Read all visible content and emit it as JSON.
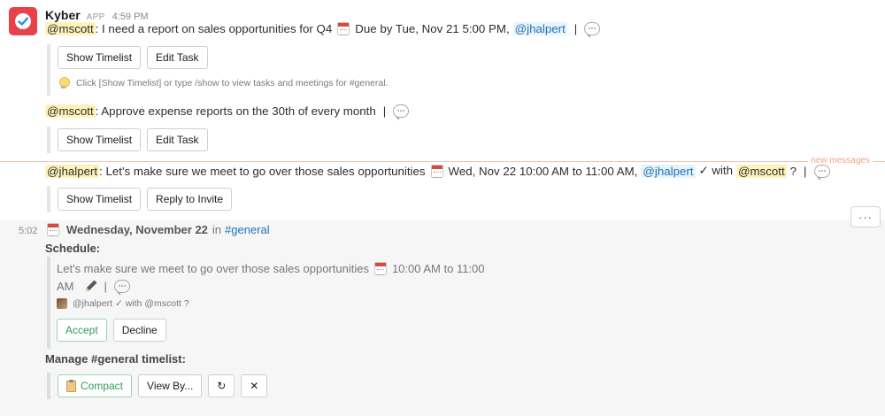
{
  "message": {
    "sender": "Kyber",
    "badge": "APP",
    "time": "4:59 PM"
  },
  "tasks": [
    {
      "assignee": "@mscott",
      "text": ": I need a report on sales opportunities for Q4",
      "due": "Due by Tue, Nov 21  5:00 PM,",
      "creator": "@jhalpert",
      "separator": "|",
      "buttons": [
        "Show Timelist",
        "Edit Task"
      ]
    },
    {
      "assignee": "@mscott",
      "text": ": Approve expense reports on the 30th of every month",
      "separator": "|",
      "buttons": [
        "Show Timelist",
        "Edit Task"
      ]
    }
  ],
  "hint": "Click [Show Timelist] or type /show to view tasks and meetings for #general.",
  "new_messages_label": "new messages",
  "meeting": {
    "organizer": "@jhalpert",
    "text": ": Let's make sure we meet to go over those sales opportunities",
    "when": "Wed, Nov 22 10:00 AM to 11:00 AM,",
    "attendee1": "@jhalpert",
    "check_with": "✓ with",
    "attendee2": "@mscott",
    "status": "?",
    "separator": "|",
    "buttons": [
      "Show Timelist",
      "Reply to Invite"
    ]
  },
  "thread": {
    "time": "5:02",
    "more_label": "···",
    "date": "Wednesday, November 22",
    "in_label": "in",
    "channel": "#general",
    "schedule_label": "Schedule:",
    "schedule_text": "Let's make sure we meet to go over those sales opportunities",
    "schedule_time": "10:00 AM to 11:00",
    "schedule_time_cont": "AM",
    "schedule_separator": "|",
    "schedule_meta": "@jhalpert ✓ with @mscott ?",
    "accept_label": "Accept",
    "decline_label": "Decline",
    "manage_label": "Manage #general timelist:",
    "compact_label": "Compact",
    "view_by_label": "View By...",
    "refresh_glyph": "↻",
    "close_glyph": "✕"
  },
  "colors": {
    "accent_link": "#1f73b7",
    "mention_bg": "#fff2b8",
    "avatar_bg": "#e8414a",
    "new_messages": "#f4a384",
    "accept_green": "#2f9e57"
  },
  "icons": [
    "kyber-logo-icon",
    "calendar-icon",
    "comment-icon",
    "lightbulb-icon",
    "pencil-icon",
    "clipboard-icon",
    "refresh-icon",
    "close-icon",
    "more-icon"
  ]
}
